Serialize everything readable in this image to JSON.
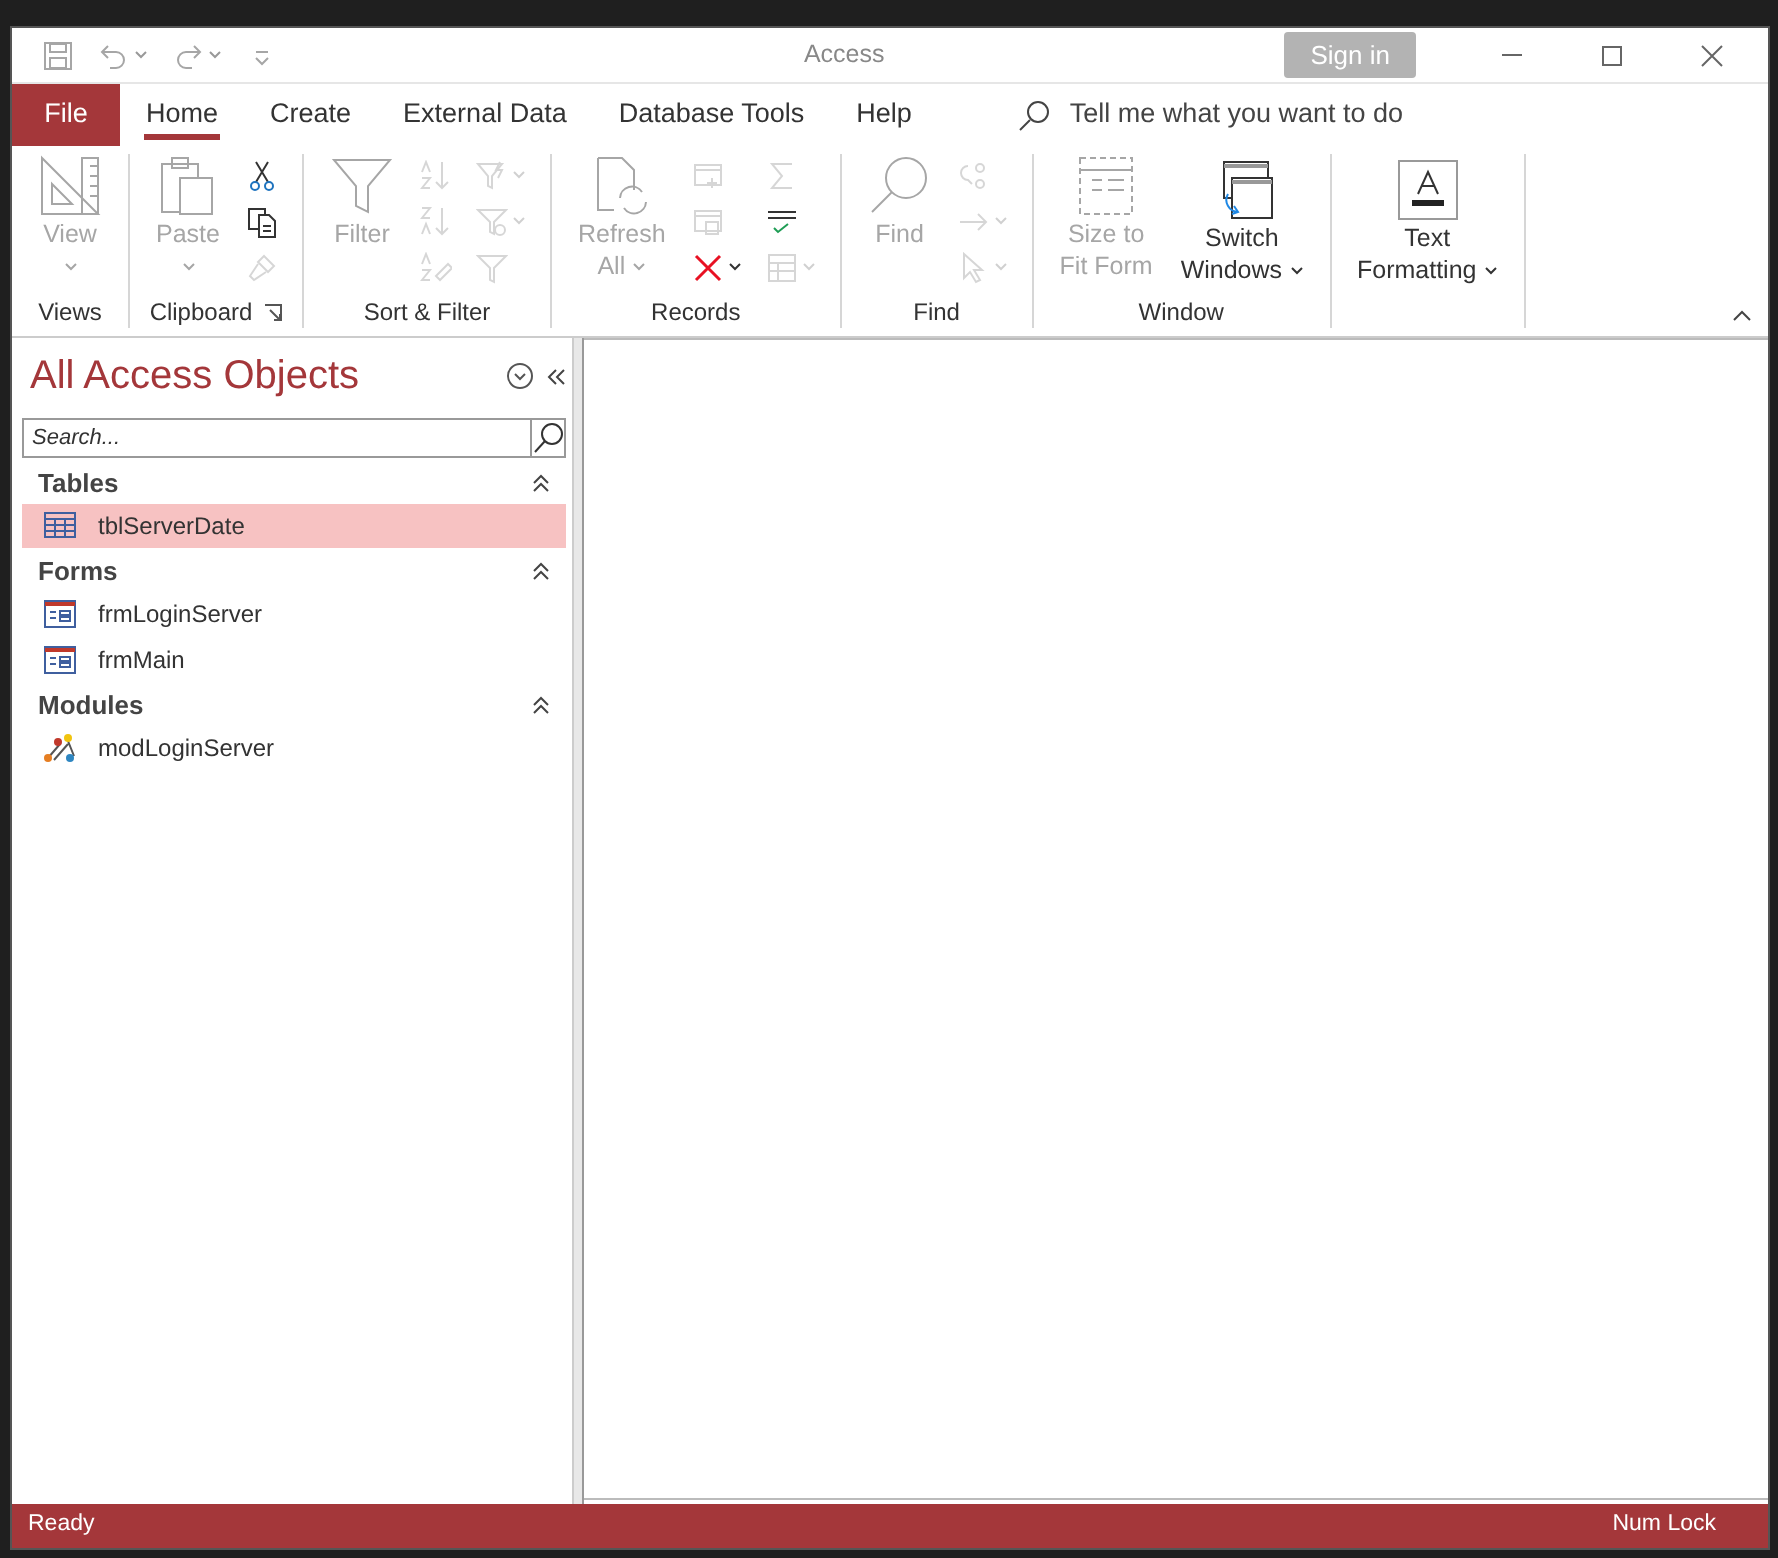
{
  "window": {
    "title": "Access",
    "sign_in": "Sign in"
  },
  "quick_access": [
    {
      "kind": "save",
      "dropdown": false
    },
    {
      "kind": "undo",
      "dropdown": true
    },
    {
      "kind": "redo",
      "dropdown": true
    },
    {
      "kind": "customize",
      "dropdown": false
    }
  ],
  "tabs": [
    {
      "label": "File",
      "kind": "file",
      "selected": false
    },
    {
      "label": "Home",
      "kind": "tab",
      "selected": true
    },
    {
      "label": "Create",
      "kind": "tab",
      "selected": false
    },
    {
      "label": "External Data",
      "kind": "tab",
      "selected": false
    },
    {
      "label": "Database Tools",
      "kind": "tab",
      "selected": false
    },
    {
      "label": "Help",
      "kind": "tab",
      "selected": false
    }
  ],
  "tell_me": {
    "placeholder": "Tell me what you want to do"
  },
  "ribbon": [
    {
      "name": "Views",
      "launcher": false,
      "large": [
        {
          "kind": "view",
          "lines": [
            "View"
          ],
          "disabled": true,
          "dropdown": true
        }
      ]
    },
    {
      "name": "Clipboard",
      "launcher": true,
      "large": [
        {
          "kind": "paste",
          "lines": [
            "Paste"
          ],
          "disabled": true,
          "dropdown": true
        }
      ],
      "small": [
        [
          {
            "kind": "cut",
            "disabled": false,
            "dropdown": false
          },
          {
            "kind": "copy",
            "disabled": false,
            "dropdown": false
          },
          {
            "kind": "painter",
            "disabled": true,
            "dropdown": false
          }
        ]
      ]
    },
    {
      "name": "Sort & Filter",
      "launcher": false,
      "large": [
        {
          "kind": "filter",
          "lines": [
            "Filter"
          ],
          "disabled": true,
          "dropdown": false
        }
      ],
      "small": [
        [
          {
            "kind": "sortasc",
            "disabled": true,
            "dropdown": false
          },
          {
            "kind": "sortdesc",
            "disabled": true,
            "dropdown": false
          },
          {
            "kind": "sortclear",
            "disabled": true,
            "dropdown": false
          }
        ],
        [
          {
            "kind": "selection",
            "disabled": true,
            "dropdown": true
          },
          {
            "kind": "advanced",
            "disabled": true,
            "dropdown": true
          },
          {
            "kind": "toggle",
            "disabled": true,
            "dropdown": false
          }
        ]
      ]
    },
    {
      "name": "Records",
      "launcher": false,
      "large": [
        {
          "kind": "refresh",
          "lines": [
            "Refresh",
            "All"
          ],
          "disabled": true,
          "dropdown": true
        }
      ],
      "small": [
        [
          {
            "kind": "new",
            "disabled": true,
            "dropdown": false
          },
          {
            "kind": "saverec",
            "disabled": true,
            "dropdown": false
          },
          {
            "kind": "delete",
            "disabled": false,
            "dropdown": true
          }
        ],
        [
          {
            "kind": "sum",
            "disabled": true,
            "dropdown": false
          },
          {
            "kind": "spelling",
            "disabled": false,
            "dropdown": false
          },
          {
            "kind": "more",
            "disabled": true,
            "dropdown": true
          }
        ]
      ]
    },
    {
      "name": "Find",
      "launcher": false,
      "large": [
        {
          "kind": "find",
          "lines": [
            "Find"
          ],
          "disabled": true,
          "dropdown": false
        }
      ],
      "small": [
        [
          {
            "kind": "replace",
            "disabled": true,
            "dropdown": false
          },
          {
            "kind": "goto",
            "disabled": true,
            "dropdown": true
          },
          {
            "kind": "select",
            "disabled": true,
            "dropdown": true
          }
        ]
      ]
    },
    {
      "name": "Window",
      "launcher": false,
      "large": [
        {
          "kind": "sizefit",
          "lines": [
            "Size to",
            "Fit Form"
          ],
          "disabled": true,
          "dropdown": false
        },
        {
          "kind": "switch",
          "lines": [
            "Switch",
            "Windows"
          ],
          "disabled": false,
          "dropdown": true
        }
      ]
    },
    {
      "launcher": false,
      "large": [
        {
          "kind": "textfmt",
          "lines": [
            "Text",
            "Formatting"
          ],
          "disabled": false,
          "dropdown": true
        }
      ]
    }
  ],
  "nav": {
    "title": "All Access Objects",
    "search": {
      "placeholder": "Search..."
    },
    "sections": [
      {
        "title": "Tables",
        "items": [
          {
            "label": "tblServerDate",
            "kind": "table",
            "selected": true
          }
        ]
      },
      {
        "title": "Forms",
        "items": [
          {
            "label": "frmLoginServer",
            "kind": "form",
            "selected": false
          },
          {
            "label": "frmMain",
            "kind": "form",
            "selected": false
          }
        ]
      },
      {
        "title": "Modules",
        "items": [
          {
            "label": "modLoginServer",
            "kind": "module",
            "selected": false
          }
        ]
      }
    ]
  },
  "status_bar": {
    "left": "Ready",
    "right": "Num Lock"
  }
}
